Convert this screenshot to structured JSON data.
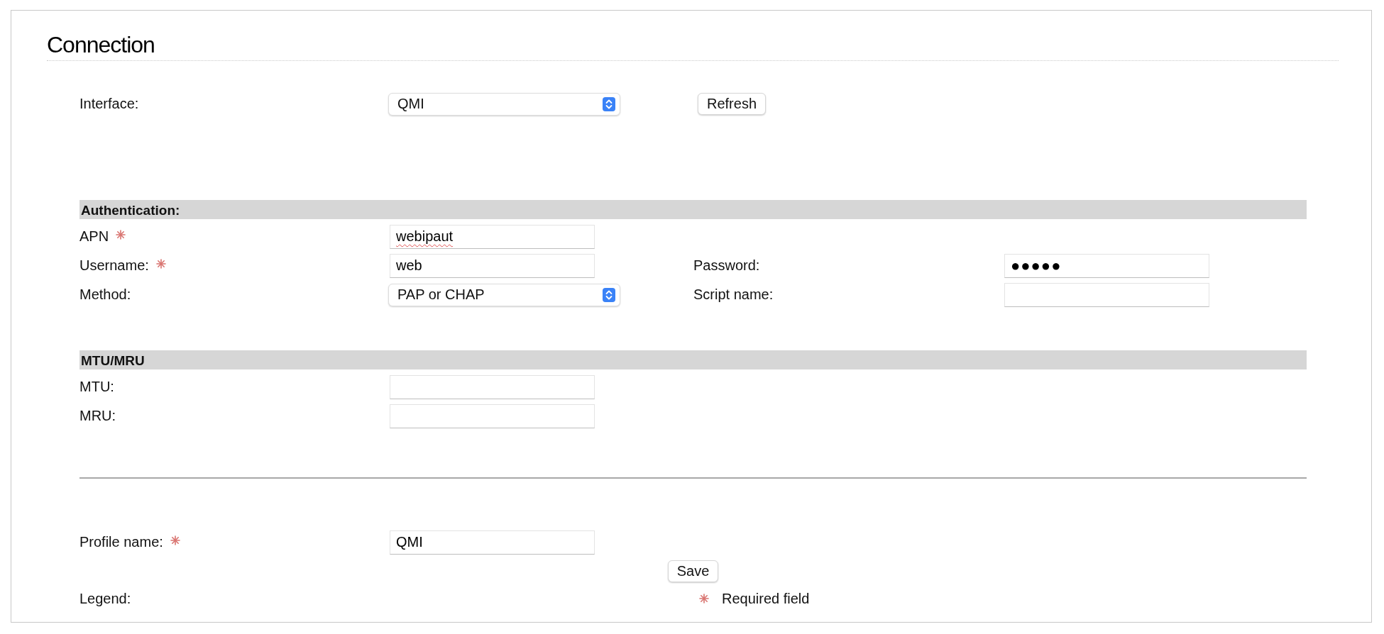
{
  "title": "Connection",
  "interface": {
    "label": "Interface:",
    "value": "QMI",
    "button": "Refresh"
  },
  "sections": [
    {
      "heading": "Authentication:",
      "rows": [
        {
          "left": {
            "label": "APN",
            "required": true,
            "kind": "text",
            "value": "webipaut",
            "misspelled": true
          }
        },
        {
          "left": {
            "label": "Username:",
            "required": true,
            "kind": "text",
            "value": "web",
            "misspelled": false
          },
          "right": {
            "label": "Password:",
            "required": false,
            "kind": "password",
            "value": "●●●●●"
          }
        },
        {
          "left": {
            "label": "Method:",
            "required": false,
            "kind": "select",
            "value": "PAP or CHAP"
          },
          "right": {
            "label": "Script name:",
            "required": false,
            "kind": "text"
          }
        }
      ]
    },
    {
      "heading": "MTU/MRU",
      "rows": [
        {
          "left": {
            "label": "MTU:",
            "required": false,
            "kind": "text"
          }
        },
        {
          "left": {
            "label": "MRU:",
            "required": false,
            "kind": "text"
          }
        }
      ]
    }
  ],
  "profile": {
    "label": "Profile name:",
    "required": true,
    "value": "QMI"
  },
  "save_button": "Save",
  "legend": {
    "label": "Legend:",
    "text": "Required field"
  }
}
